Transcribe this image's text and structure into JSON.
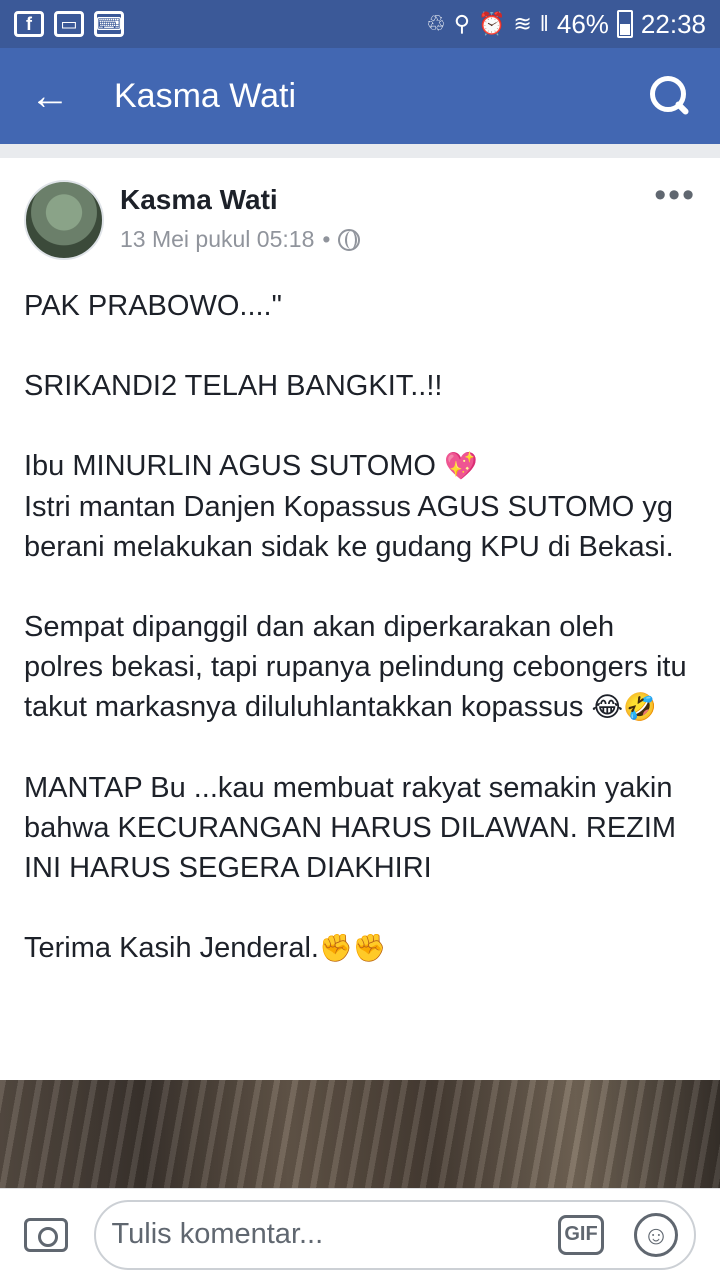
{
  "status_bar": {
    "left_icons": [
      "facebook-icon",
      "car-icon",
      "keyboard-icon"
    ],
    "signal": "‖",
    "battery_percent": "46%",
    "time": "22:38"
  },
  "header": {
    "title": "Kasma Wati"
  },
  "post": {
    "author": "Kasma Wati",
    "timestamp": "13 Mei pukul 05:18",
    "separator": "•",
    "more": "•••",
    "lines": {
      "l1": "PAK PRABOWO....\"",
      "l2": "SRIKANDI2 TELAH BANGKIT..!!",
      "l3a": "Ibu MINURLIN AGUS SUTOMO ",
      "l3emoji": "💖",
      "l4": "Istri mantan Danjen Kopassus AGUS SUTOMO yg berani melakukan sidak ke gudang KPU di Bekasi.",
      "l5a": "Sempat dipanggil dan akan diperkarakan oleh polres bekasi, tapi rupanya pelindung cebongers itu takut markasnya diluluhlantakkan kopassus ",
      "l5emoji": "😂🤣",
      "l6": "MANTAP Bu ...kau membuat rakyat semakin yakin bahwa KECURANGAN HARUS DILAWAN. REZIM INI HARUS SEGERA DIAKHIRI",
      "l7a": "Terima Kasih Jenderal.",
      "l7emoji": "✊✊"
    }
  },
  "comment_bar": {
    "placeholder": "Tulis komentar...",
    "gif_label": "GIF",
    "smile": "☺"
  }
}
